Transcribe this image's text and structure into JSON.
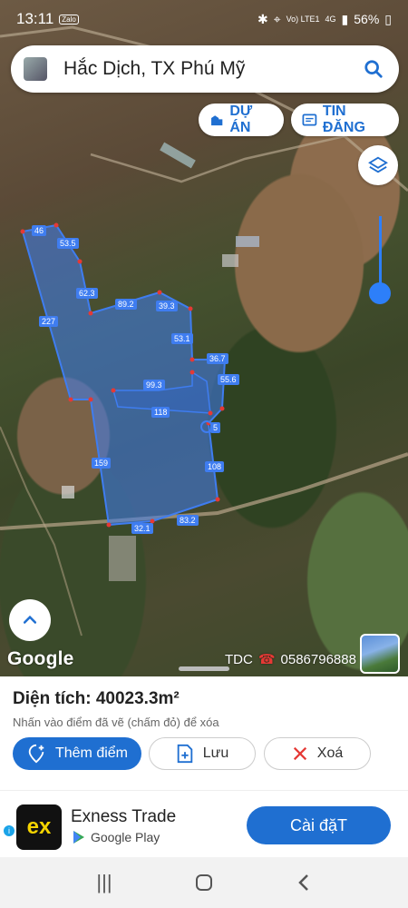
{
  "status_bar": {
    "time": "13:11",
    "app_badge": "Zalo",
    "network": "Vo) LTE1",
    "signal_type": "4G",
    "battery": "56%"
  },
  "search": {
    "query": "Hắc Dịch, TX Phú Mỹ"
  },
  "chips": {
    "du_an": "DỰ ÁN",
    "tin_dang": "TIN ĐĂNG"
  },
  "map": {
    "google_label": "Google",
    "contact_name": "TDC",
    "contact_phone": "0586796888",
    "edge_labels": [
      "46",
      "53.5",
      "62.3",
      "89.2",
      "39.3",
      "53.1",
      "36.7",
      "55.6",
      "99.3",
      "118",
      "108",
      "83.2",
      "32.1",
      "159",
      "227",
      "5"
    ]
  },
  "sheet": {
    "area_label": "Diện tích: 40023.3m²",
    "hint": "Nhấn vào điểm đã vẽ (chấm đỏ) để xóa",
    "add_point": "Thêm điểm",
    "save": "Lưu",
    "delete": "Xoá"
  },
  "ad": {
    "logo": "ex",
    "title": "Exness Trade",
    "store": "Google Play",
    "install": "Cài đặT",
    "info": "i"
  },
  "colors": {
    "accent": "#1f6fd1",
    "polygon_fill": "#3f7df0",
    "marker_red": "#e53935"
  }
}
